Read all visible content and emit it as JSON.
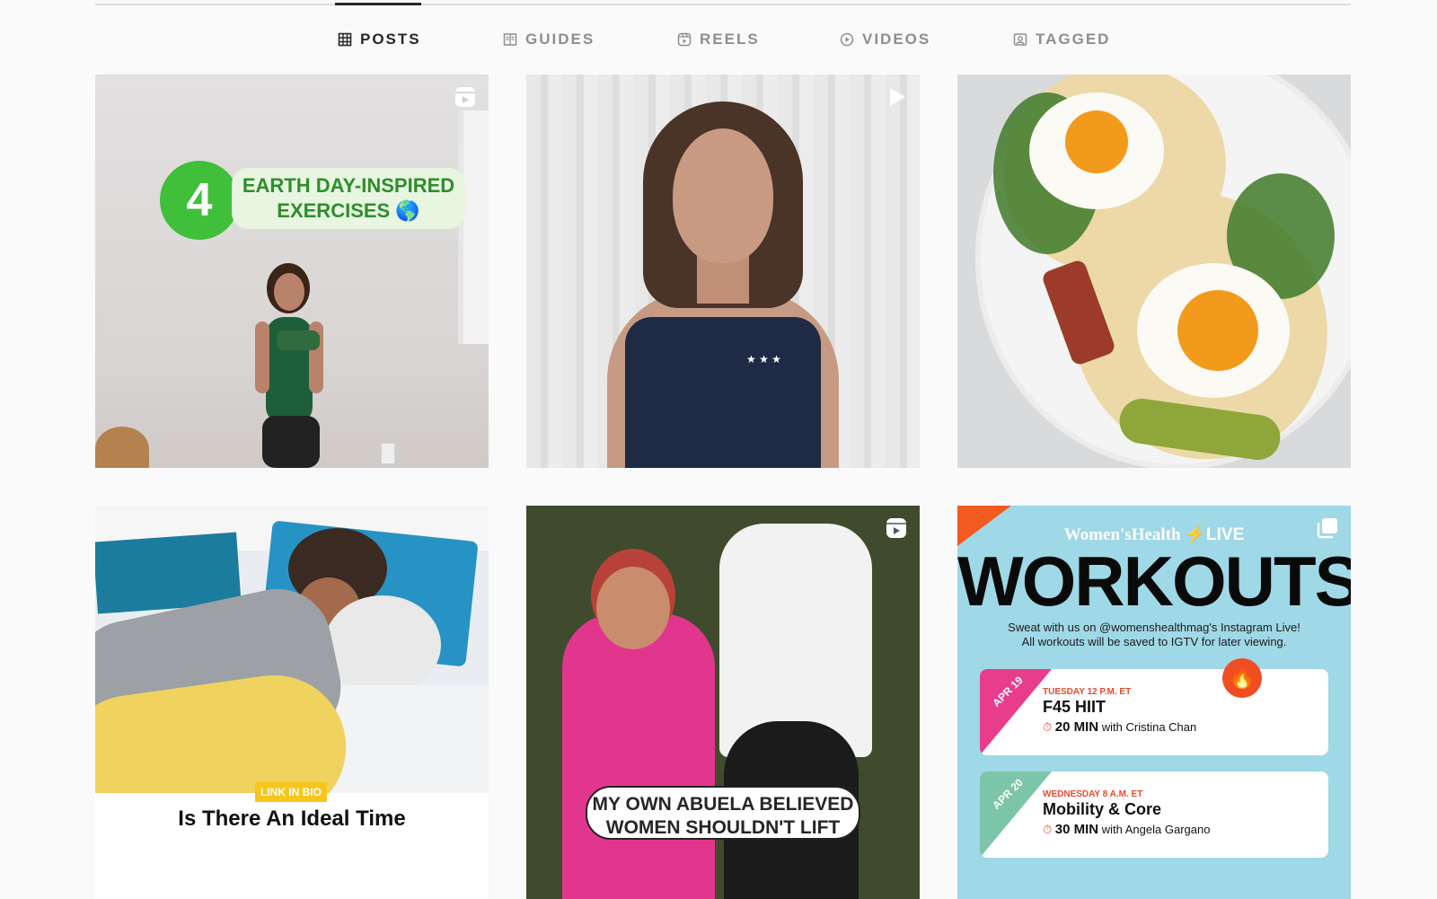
{
  "tabs": [
    {
      "label": "POSTS",
      "icon": "grid-icon",
      "active": true
    },
    {
      "label": "GUIDES",
      "icon": "guides-icon",
      "active": false
    },
    {
      "label": "REELS",
      "icon": "reels-icon",
      "active": false
    },
    {
      "label": "VIDEOS",
      "icon": "video-icon",
      "active": false
    },
    {
      "label": "TAGGED",
      "icon": "tagged-icon",
      "active": false
    }
  ],
  "posts": {
    "p1": {
      "badge": "reel-icon",
      "number": "4",
      "title": "EARTH DAY-INSPIRED EXERCISES 🌎"
    },
    "p2": {
      "badge": "video-icon",
      "stars": "★ ★ ★"
    },
    "p3": {},
    "p4": {
      "pill": "LINK IN BIO",
      "headline": "Is There An Ideal Time"
    },
    "p5": {
      "badge": "reel-icon",
      "caption": "MY OWN ABUELA BELIEVED WOMEN SHOULDN'T LIFT"
    },
    "p6": {
      "badge": "carousel-icon",
      "brand": "Women'sHealth",
      "brand_live": "LIVE",
      "headline": "WORKOUTS",
      "sub_line1": "Sweat with us on @womenshealthmag's Instagram Live!",
      "sub_line2": "All workouts will be saved to IGTV for later viewing.",
      "sessions": [
        {
          "date": "APR 19",
          "when": "TUESDAY 12 P.M. ET",
          "title": "F45 HIIT",
          "duration": "20 MIN",
          "with": "with Cristina Chan"
        },
        {
          "date": "APR 20",
          "when": "WEDNESDAY 8 A.M. ET",
          "title": "Mobility & Core",
          "duration": "30 MIN",
          "with": "with Angela Gargano"
        }
      ]
    }
  },
  "colors": {
    "active_tab": "#262626",
    "inactive_tab": "#8e8e8e",
    "background": "#fafafa"
  }
}
